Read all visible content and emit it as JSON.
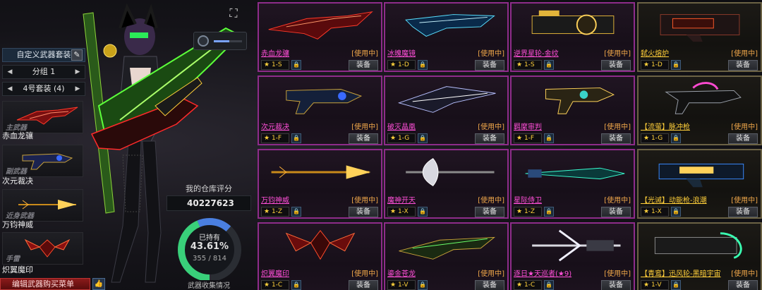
{
  "left_panel": {
    "custom_title": "自定义武器套装",
    "group_label": "分组 1",
    "suit_label": "4号套装 (4)",
    "slots": [
      {
        "category": "主武器",
        "name": "赤血龙骧"
      },
      {
        "category": "副武器",
        "name": "次元裁决"
      },
      {
        "category": "近身武器",
        "name": "万钧神威"
      },
      {
        "category": "手雷",
        "name": "炽翼魔印"
      }
    ],
    "buy_menu_label": "编辑武器购买菜单"
  },
  "zoom_level": 0.55,
  "score": {
    "label": "我的仓库评分",
    "value": "40227623",
    "owned_label": "已持有",
    "percent": "43.61%",
    "percent_value": 43.61,
    "count": "355 / 814",
    "collect_label": "武器收集情况"
  },
  "colors": {
    "accent_pink": "#ff4fd8",
    "accent_gold": "#ffcf3a",
    "use_orange": "#f0a74a",
    "donut_green": "#39d07a",
    "donut_blue": "#4a7fe0"
  },
  "weapons": [
    {
      "name": "赤血龙骧",
      "status": "[使用中]",
      "grade": "1-S",
      "equip": "装备",
      "tier": "pink",
      "icon": "red-dragon-rifle"
    },
    {
      "name": "冰魄魔镜",
      "status": "[使用中]",
      "grade": "1-D",
      "equip": "装备",
      "tier": "pink",
      "icon": "ice-crystal-rifle"
    },
    {
      "name": "逆界星轮-金纹",
      "status": "[使用中]",
      "grade": "1-S",
      "equip": "装备",
      "tier": "pink",
      "icon": "gold-wheel-cannon"
    },
    {
      "name": "弑火熔炉",
      "status": "[使用中]",
      "grade": "1-D",
      "equip": "装备",
      "tier": "gold",
      "icon": "fire-furnace-gun"
    },
    {
      "name": "次元裁决",
      "status": "[使用中]",
      "grade": "1-F",
      "equip": "装备",
      "tier": "pink",
      "icon": "dimension-pistol"
    },
    {
      "name": "破灭晶凰",
      "status": "[使用中]",
      "grade": "1-G",
      "equip": "装备",
      "tier": "pink",
      "icon": "crystal-phoenix-blade"
    },
    {
      "name": "羁縻审判",
      "status": "[使用中]",
      "grade": "1-F",
      "equip": "装备",
      "tier": "pink",
      "icon": "judgement-pistol"
    },
    {
      "name": "【流萤】脉冲枪",
      "status": "[使用中]",
      "grade": "1-G",
      "equip": "装备",
      "tier": "gold",
      "icon": "pulse-gun"
    },
    {
      "name": "万钧神威",
      "status": "[使用中]",
      "grade": "1-Z",
      "equip": "装备",
      "tier": "pink",
      "icon": "golden-spear"
    },
    {
      "name": "魔神开天",
      "status": "[使用中]",
      "grade": "1-X",
      "equip": "装备",
      "tier": "pink",
      "icon": "demon-axe"
    },
    {
      "name": "星际侍卫",
      "status": "[使用中]",
      "grade": "1-Z",
      "equip": "装备",
      "tier": "pink",
      "icon": "star-guard-sword"
    },
    {
      "name": "【光诫】动能枪-浪潮",
      "status": "[使用中]",
      "grade": "1-X",
      "equip": "装备",
      "tier": "gold",
      "icon": "kinetic-gun"
    },
    {
      "name": "炽翼魔印",
      "status": "[使用中]",
      "grade": "1-C",
      "equip": "装备",
      "tier": "pink",
      "icon": "winged-grenade"
    },
    {
      "name": "鎏金苍龙",
      "status": "[使用中]",
      "grade": "1-V",
      "equip": "装备",
      "tier": "pink",
      "icon": "gilded-dragon-rifle"
    },
    {
      "name": "逐日★天巡者(★9)",
      "status": "[使用中]",
      "grade": "1-C",
      "equip": "装备",
      "tier": "pink",
      "icon": "sun-chaser-crossbow"
    },
    {
      "name": "【青鸾】迅风轮-黑暗宇宙",
      "status": "[使用中]",
      "grade": "1-V",
      "equip": "装备",
      "tier": "gold",
      "icon": "wind-wheel-gun"
    }
  ]
}
